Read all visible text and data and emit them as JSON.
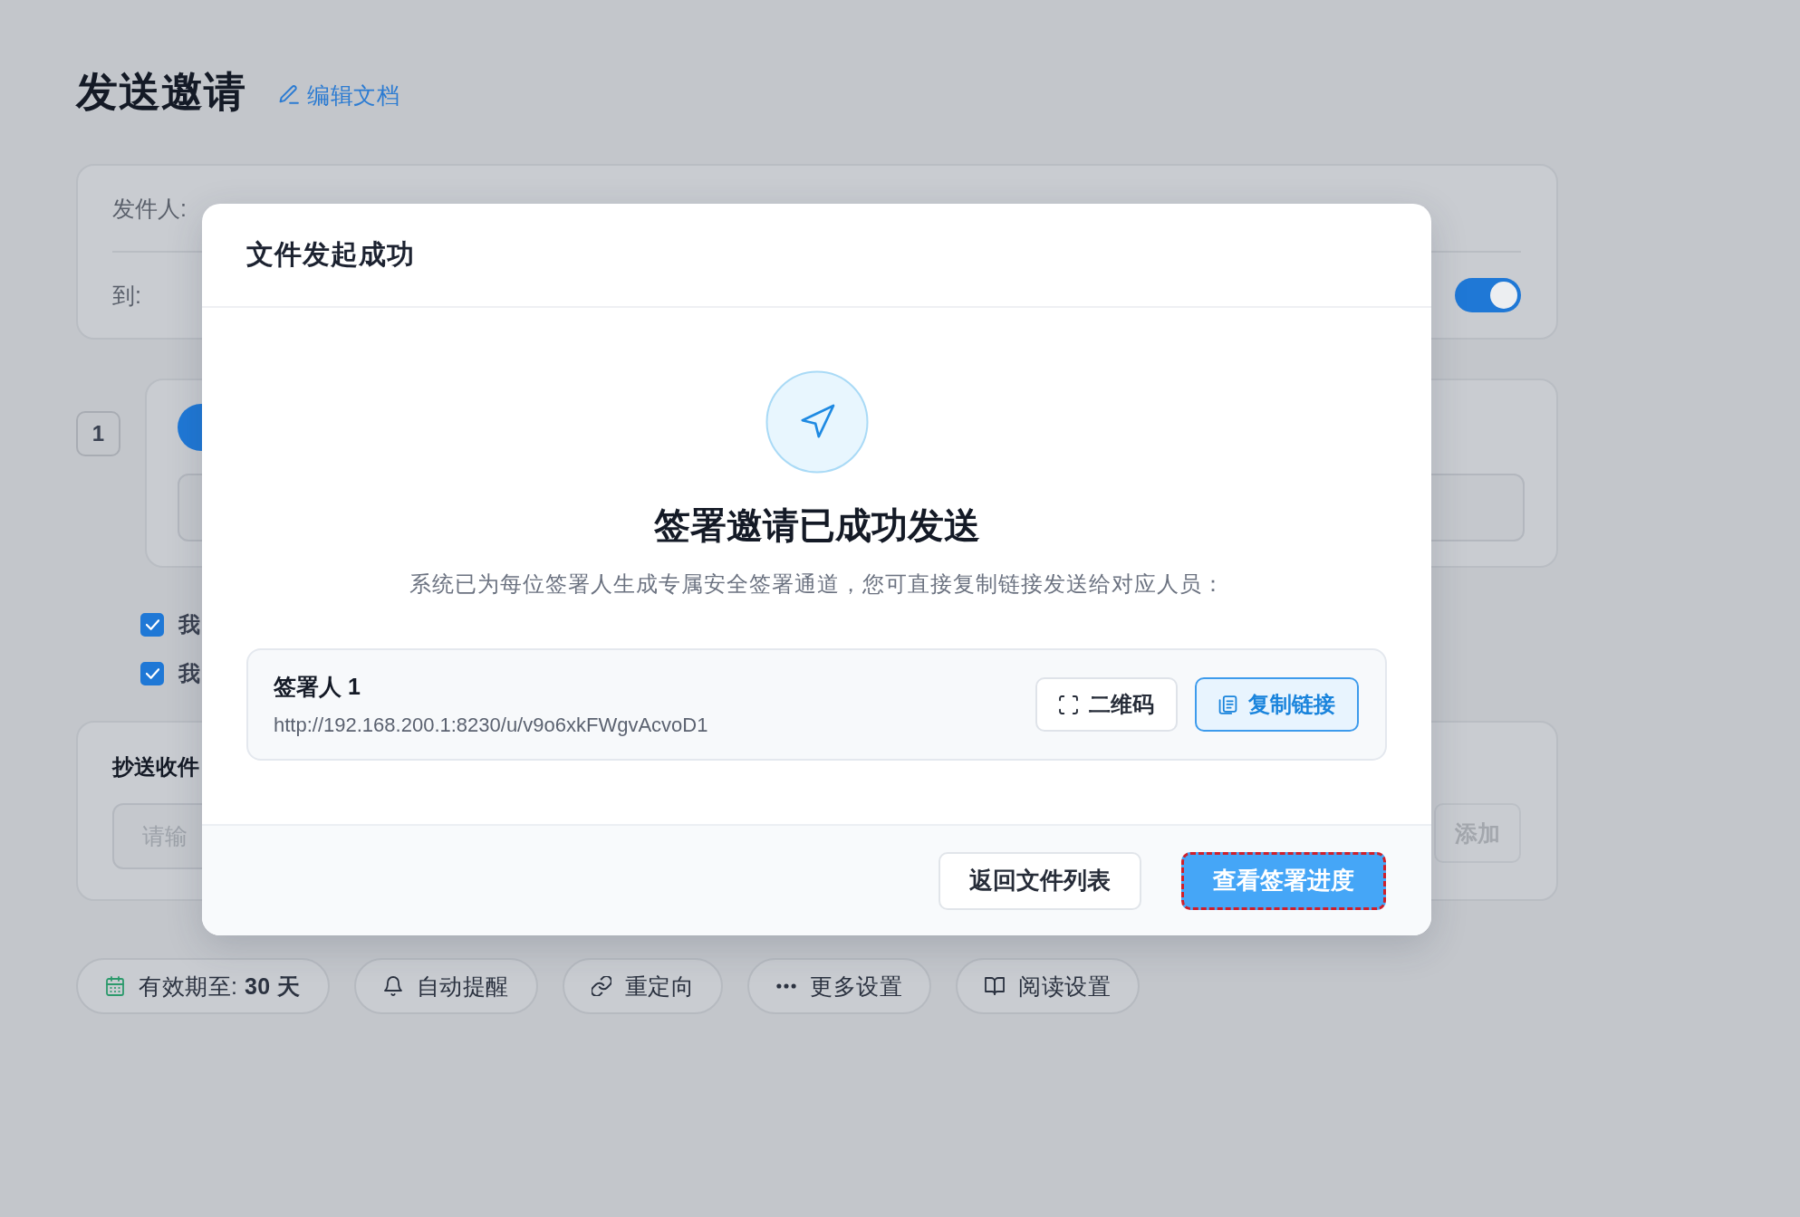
{
  "page": {
    "title": "发送邀请",
    "edit_link": "编辑文档"
  },
  "sender_card": {
    "sender_label": "发件人:",
    "recipient_label": "到:",
    "toggle": {
      "on": true
    }
  },
  "signer_step": {
    "number": "1"
  },
  "agreements": [
    {
      "label": "我",
      "checked": true
    },
    {
      "label": "我",
      "checked": true
    }
  ],
  "cc_card": {
    "title": "抄送收件",
    "input": {
      "placeholder": "请输"
    },
    "add_button": {
      "label": "添加",
      "disabled": true
    }
  },
  "toolbar": [
    {
      "kind": "calendar",
      "label": "有效期至: **30 天**"
    },
    {
      "kind": "bell",
      "label": "自动提醒"
    },
    {
      "kind": "link",
      "label": "重定向"
    },
    {
      "kind": "dots",
      "label": "更多设置"
    },
    {
      "kind": "book",
      "label": "阅读设置"
    }
  ],
  "dialog": {
    "title": "文件发起成功",
    "heading": "签署邀请已成功发送",
    "description": "系统已为每位签署人生成专属安全签署通道，您可直接复制链接发送给对应人员：",
    "signers": [
      {
        "name": "签署人 1",
        "url": "http://192.168.200.1:8230/u/v9o6xkFWgvAcvoD1",
        "actions": [
          {
            "kind": "qr",
            "label": "二维码"
          },
          {
            "kind": "copy",
            "label": "复制链接"
          }
        ]
      }
    ],
    "buttons": [
      {
        "kind": "secondary",
        "label": "返回文件列表",
        "focused": false
      },
      {
        "kind": "primary",
        "label": "查看签署进度",
        "focused": true
      }
    ]
  }
}
